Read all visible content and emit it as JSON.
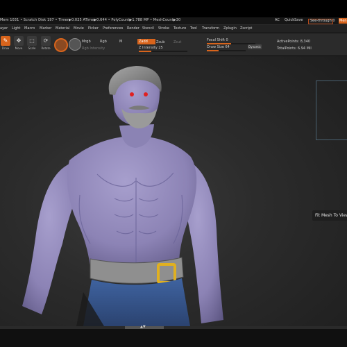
{
  "status": {
    "info": "Mem 1031 • Scratch Disk 197 • Timer▶0.025 ATime▶0.644 • PolyCount▶1.788 MP • MeshCount▶30",
    "ac_label": "AC",
    "quicksave_label": "QuickSave",
    "seethrough_label": "See-through 0",
    "seethrough_value": 0,
    "menus_label": "Men"
  },
  "menubar": [
    "ayer",
    "Light",
    "Macro",
    "Marker",
    "Material",
    "Movie",
    "Picker",
    "Preferences",
    "Render",
    "Stencil",
    "Stroke",
    "Texture",
    "Tool",
    "Transform",
    "Zplugin",
    "Zscript"
  ],
  "shelf": {
    "tools": [
      {
        "label": "Draw",
        "icon": "✎"
      },
      {
        "label": "Move",
        "icon": "✥"
      },
      {
        "label": "Scale",
        "icon": "⬚"
      },
      {
        "label": "Rotate",
        "icon": "⟳"
      }
    ],
    "mrgb": "Mrgb",
    "rgb": "Rgb",
    "m": "M",
    "rgb_intensity": "Rgb Intensity",
    "zadd": "Zadd",
    "zsub": "Zsub",
    "zcut": "Zcut",
    "z_intensity": "Z Intensity 25",
    "focal_shift": "Focal Shift 0",
    "draw_size": "Draw Size 64",
    "dynamic": "Dynamic",
    "active_points": "ActivePoints: 8,340",
    "total_points": "TotalPoints: 6.94 Mil"
  },
  "viewport": {
    "tooltip": "Fit Mesh To View"
  },
  "colors": {
    "accent": "#d8641c",
    "skin": "#9188b8",
    "pants": "#3d5f93",
    "belt": "#8f8f8f",
    "buckle": "#e0b020",
    "hair": "#8a8a8a",
    "eyes": "#e02020"
  }
}
